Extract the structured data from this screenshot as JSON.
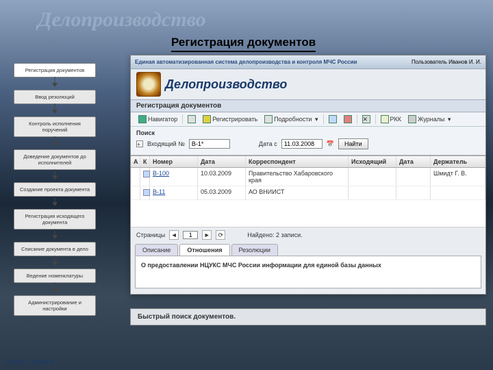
{
  "slide": {
    "title": "Делопроизводство",
    "subtitle": "Регистрация документов",
    "caption": "Быстрый поиск документов.",
    "brand": "STINS  COMAN"
  },
  "sidebar": {
    "items": [
      {
        "label": "Регистрация документов"
      },
      {
        "label": "Ввод резолюций"
      },
      {
        "label": "Контроль исполнения поручений"
      },
      {
        "label": "Доведение документов до исполнителей"
      },
      {
        "label": "Создание проекта документа"
      },
      {
        "label": "Регистрация исходящего документа"
      },
      {
        "label": "Списание документа в дело"
      },
      {
        "label": "Ведение номенклатуры"
      },
      {
        "label": "Администрирование и настройки"
      }
    ]
  },
  "app": {
    "titlebar": "Единая автоматизированная система делопроизводства и контроля МЧС России",
    "user_label": "Пользователь",
    "user_name": "Иванов И. И.",
    "app_name": "Делопроизводство",
    "section": "Регистрация документов",
    "toolbar": {
      "navigator": "Навигатор",
      "register": "Регистрировать",
      "details": "Подробности",
      "rkk": "РКК",
      "journals": "Журналы"
    },
    "search": {
      "title": "Поиск",
      "incoming_label": "Входящий №",
      "incoming_value": "В-1*",
      "date_label": "Дата с",
      "date_value": "11.03.2008",
      "date_icon": "📅",
      "find": "Найти"
    },
    "grid": {
      "columns": {
        "a": "А",
        "k": "К",
        "num": "Номер",
        "date": "Дата",
        "corr": "Корреспондент",
        "out": "Исходящий",
        "d2": "Дата",
        "hold": "Держатель"
      },
      "rows": [
        {
          "num": "В-100",
          "date": "10.03.2009",
          "corr": "Правительство Хабаровского края",
          "out": "",
          "d2": "",
          "hold": "Шмидт Г. В."
        },
        {
          "num": "В-11",
          "date": "05.03.2009",
          "corr": "АО ВНИИСТ",
          "out": "",
          "d2": "",
          "hold": ""
        }
      ]
    },
    "pager": {
      "label": "Страницы",
      "page": "1",
      "found": "Найдено: 2 записи."
    },
    "tabs": {
      "desc": "Описание",
      "rel": "Отношения",
      "res": "Резолюции"
    },
    "description": "О предоставлении НЦУКС МЧС России информации для единой базы данных"
  }
}
